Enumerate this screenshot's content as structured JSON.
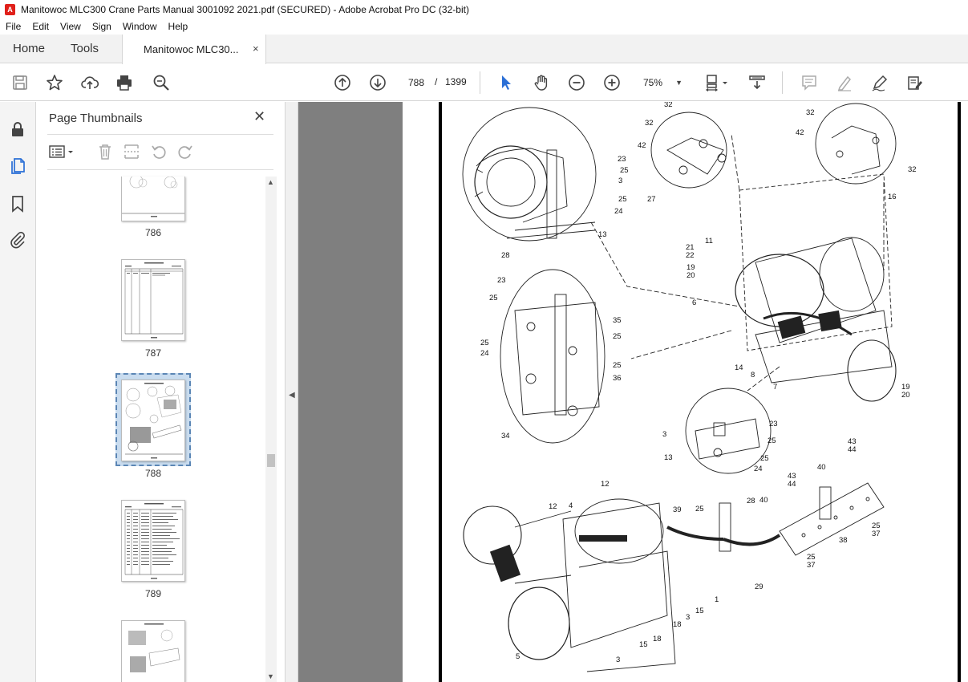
{
  "window": {
    "title": "Manitowoc MLC300 Crane Parts Manual 3001092 2021.pdf (SECURED) - Adobe Acrobat Pro DC (32-bit)",
    "app_icon": "acrobat-icon"
  },
  "menu": [
    "File",
    "Edit",
    "View",
    "Sign",
    "Window",
    "Help"
  ],
  "tabs": {
    "home": "Home",
    "tools": "Tools",
    "document": "Manitowoc MLC30...",
    "close": "×"
  },
  "toolbar": {
    "current_page": "788",
    "separator": "/",
    "total_pages": "1399",
    "zoom": "75%"
  },
  "thumbnails": {
    "title": "Page Thumbnails",
    "close": "✕",
    "pages": [
      "786",
      "787",
      "788",
      "789"
    ],
    "selected_page": "788"
  },
  "drawing": {
    "callouts": [
      "32",
      "32",
      "42",
      "27",
      "32",
      "42",
      "32",
      "16",
      "23",
      "25",
      "3",
      "25",
      "24",
      "13",
      "28",
      "11",
      "21",
      "22",
      "19",
      "20",
      "6",
      "23",
      "25",
      "35",
      "25",
      "25",
      "24",
      "25",
      "36",
      "34",
      "14",
      "8",
      "7",
      "19",
      "20",
      "23",
      "3",
      "25",
      "13",
      "25",
      "24",
      "43",
      "44",
      "40",
      "43",
      "44",
      "40",
      "12",
      "12",
      "4",
      "39",
      "25",
      "28",
      "25",
      "37",
      "38",
      "25",
      "37",
      "29",
      "1",
      "15",
      "3",
      "18",
      "15",
      "18",
      "5",
      "3"
    ]
  }
}
